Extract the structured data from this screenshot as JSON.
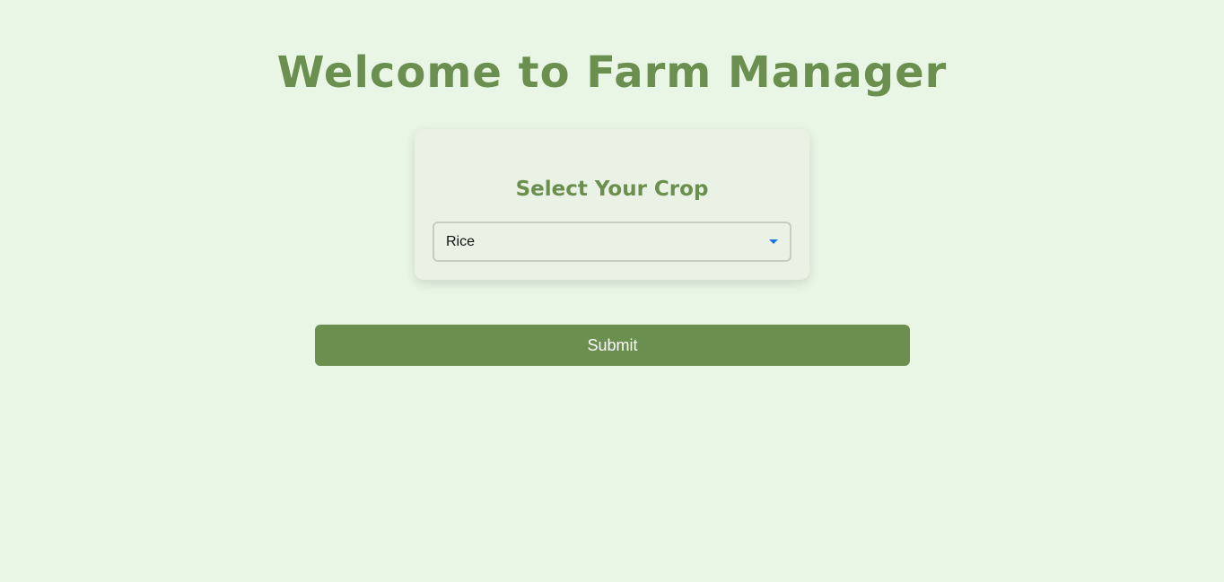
{
  "page": {
    "title": "Welcome to Farm Manager"
  },
  "crop_card": {
    "title": "Select Your Crop",
    "select": {
      "selected": "Rice"
    }
  },
  "actions": {
    "submit_label": "Submit"
  },
  "icons": {
    "dropdown": "chevron-down-icon"
  },
  "colors": {
    "background": "#e9f5e5",
    "accent": "#6a8f4e",
    "dropdown_arrow": "#1a73e8"
  }
}
